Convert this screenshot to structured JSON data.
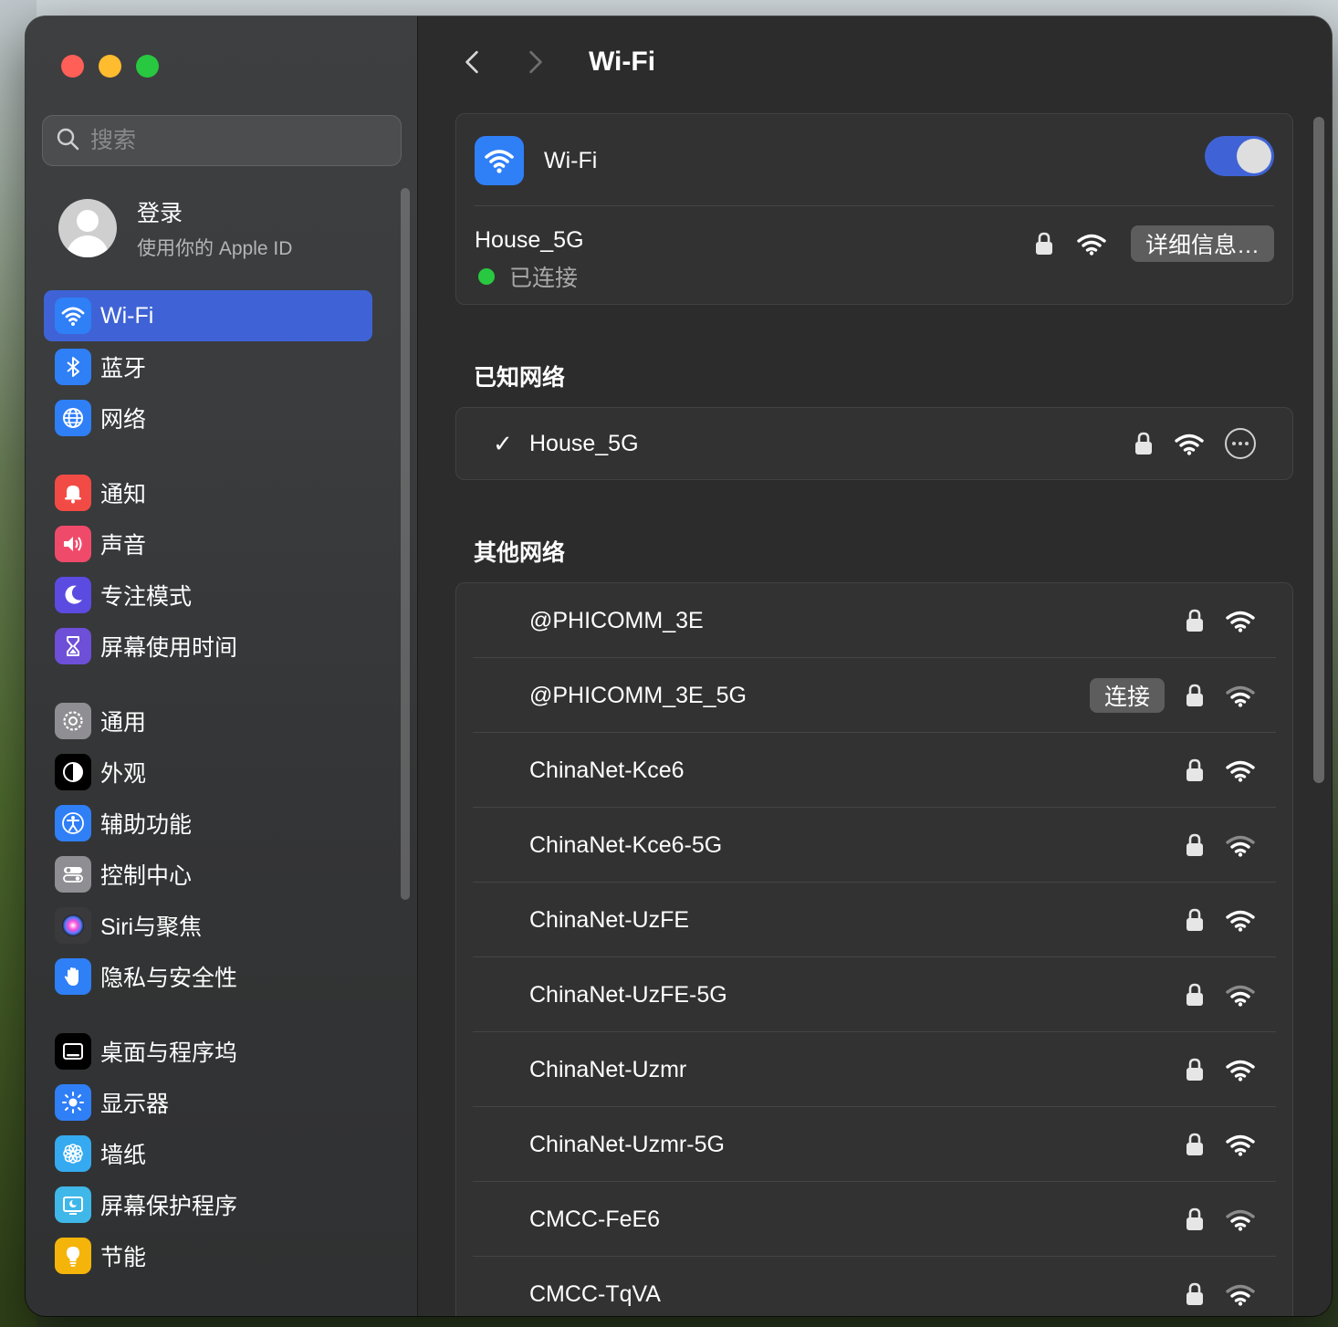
{
  "window": {
    "title": "Wi-Fi"
  },
  "sidebar": {
    "search_placeholder": "搜索",
    "account": {
      "title": "登录",
      "subtitle": "使用你的 Apple ID"
    },
    "items": [
      {
        "label": "Wi-Fi",
        "icon": "wifi-icon",
        "color": "#2f7ff7",
        "active": true
      },
      {
        "label": "蓝牙",
        "icon": "bluetooth-icon",
        "color": "#2f7ff7"
      },
      {
        "label": "网络",
        "icon": "globe-icon",
        "color": "#2f7ff7"
      },
      {
        "label": "通知",
        "icon": "bell-icon",
        "color": "#f24b45"
      },
      {
        "label": "声音",
        "icon": "speaker-icon",
        "color": "#f04a6b"
      },
      {
        "label": "专注模式",
        "icon": "moon-icon",
        "color": "#5b4be0"
      },
      {
        "label": "屏幕使用时间",
        "icon": "hourglass-icon",
        "color": "#6d4fd8"
      },
      {
        "label": "通用",
        "icon": "gear-icon",
        "color": "#8e8e93"
      },
      {
        "label": "外观",
        "icon": "appearance-icon",
        "color": "#000000"
      },
      {
        "label": "辅助功能",
        "icon": "accessibility-icon",
        "color": "#2f7ff7"
      },
      {
        "label": "控制中心",
        "icon": "control-center-icon",
        "color": "#8e8e93"
      },
      {
        "label": "Siri与聚焦",
        "icon": "siri-icon",
        "color": "#3a3a3c"
      },
      {
        "label": "隐私与安全性",
        "icon": "hand-icon",
        "color": "#2f7ff7"
      },
      {
        "label": "桌面与程序坞",
        "icon": "dock-icon",
        "color": "#000000"
      },
      {
        "label": "显示器",
        "icon": "sun-icon",
        "color": "#2f7ff7"
      },
      {
        "label": "墙纸",
        "icon": "flower-icon",
        "color": "#35aaf0"
      },
      {
        "label": "屏幕保护程序",
        "icon": "screensaver-icon",
        "color": "#3fb7e8"
      },
      {
        "label": "节能",
        "icon": "lightbulb-icon",
        "color": "#f5b40a"
      }
    ]
  },
  "main": {
    "title": "Wi-Fi",
    "wifi": {
      "label": "Wi-Fi",
      "enabled": true
    },
    "current": {
      "name": "House_5G",
      "status": "已连接",
      "details_button": "详细信息…"
    },
    "known_title": "已知网络",
    "known": [
      {
        "name": "House_5G",
        "checked": true
      }
    ],
    "other_title": "其他网络",
    "connect_label": "连接",
    "other": [
      {
        "name": "@PHICOMM_3E",
        "signal": "full"
      },
      {
        "name": "@PHICOMM_3E_5G",
        "signal": "weak",
        "show_connect": true
      },
      {
        "name": "ChinaNet-Kce6",
        "signal": "full"
      },
      {
        "name": "ChinaNet-Kce6-5G",
        "signal": "weak"
      },
      {
        "name": "ChinaNet-UzFE",
        "signal": "full"
      },
      {
        "name": "ChinaNet-UzFE-5G",
        "signal": "weak"
      },
      {
        "name": "ChinaNet-Uzmr",
        "signal": "full"
      },
      {
        "name": "ChinaNet-Uzmr-5G",
        "signal": "full"
      },
      {
        "name": "CMCC-FeE6",
        "signal": "weak"
      },
      {
        "name": "CMCC-TqVA",
        "signal": "weak"
      }
    ]
  }
}
